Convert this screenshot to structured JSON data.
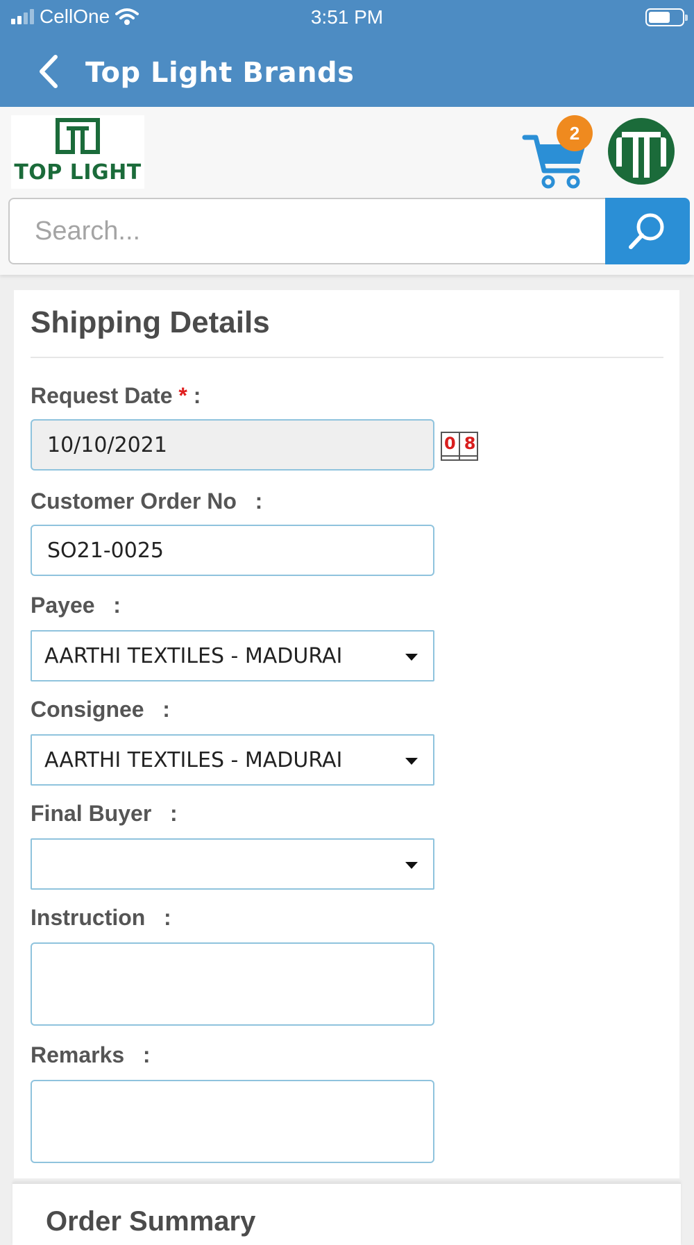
{
  "status_bar": {
    "carrier": "CellOne",
    "time": "3:51 PM"
  },
  "nav": {
    "title": "Top Light Brands"
  },
  "header": {
    "logo_text": "TOP LIGHT",
    "cart_count": "2",
    "search_placeholder": "Search..."
  },
  "shipping": {
    "title": "Shipping Details",
    "request_date": {
      "label": "Request Date ",
      "required_mark": "*",
      "colon": " :",
      "value": "10/10/2021"
    },
    "calendar_icon_text": "08",
    "customer_order_no": {
      "label": "Customer Order No   :",
      "value": "SO21-0025"
    },
    "payee": {
      "label": "Payee   :",
      "value": "AARTHI TEXTILES - MADURAI"
    },
    "consignee": {
      "label": "Consignee   :",
      "value": "AARTHI TEXTILES - MADURAI"
    },
    "final_buyer": {
      "label": "Final Buyer   :",
      "value": ""
    },
    "instruction": {
      "label": "Instruction   :",
      "value": ""
    },
    "remarks": {
      "label": "Remarks   :",
      "value": ""
    }
  },
  "order_summary": {
    "title": "Order Summary"
  },
  "colors": {
    "nav_blue": "#4d8cc3",
    "search_blue": "#2b8fd6",
    "badge_orange": "#ef8a1f",
    "brand_green": "#1b6b3a",
    "required_red": "#e02020"
  },
  "icons": [
    "back-chevron-icon",
    "wifi-icon",
    "battery-icon",
    "cart-icon",
    "search-icon",
    "calendar-icon",
    "dropdown-caret-icon"
  ]
}
